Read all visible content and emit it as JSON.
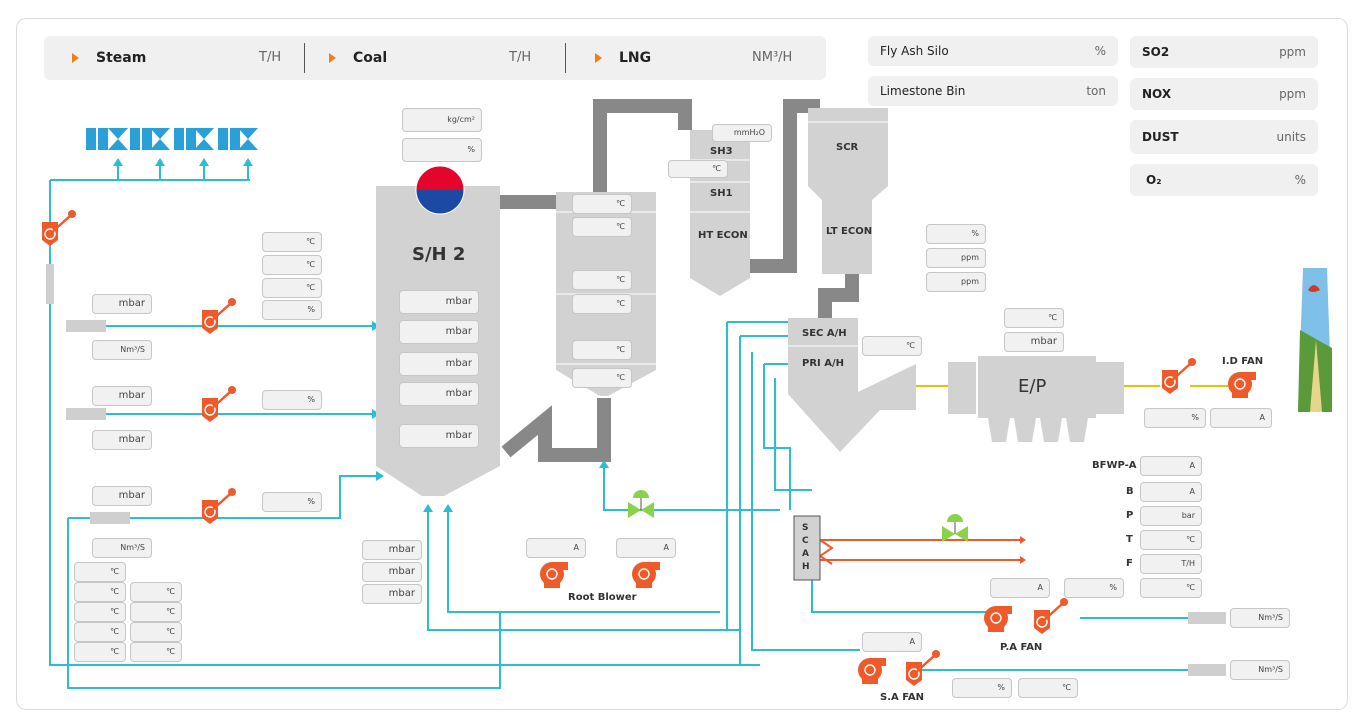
{
  "topbar": {
    "items": [
      {
        "label": "Steam",
        "unit": "T/H"
      },
      {
        "label": "Coal",
        "unit": "T/H"
      },
      {
        "label": "LNG",
        "unit": "NM³/H"
      }
    ]
  },
  "silo_panels": [
    {
      "label": "Fly Ash Silo",
      "unit": "%"
    },
    {
      "label": "Limestone Bin",
      "unit": "ton"
    }
  ],
  "emission_panels": [
    {
      "label": "SO2",
      "unit": "ppm"
    },
    {
      "label": "NOX",
      "unit": "ppm"
    },
    {
      "label": "DUST",
      "unit": "units"
    },
    {
      "label": "O₂",
      "unit": "%"
    }
  ],
  "equipment": {
    "sh2": "S/H 2",
    "sh3": "SH3",
    "sh1": "SH1",
    "ht_econ": "HT ECON",
    "scr": "SCR",
    "lt_econ": "LT ECON",
    "sec_ah": "SEC A/H",
    "pri_ah": "PRI A/H",
    "ep": "E/P",
    "id_fan": "I.D FAN",
    "pa_fan": "P.A FAN",
    "sa_fan": "S.A FAN",
    "root_blower": "Root Blower",
    "scah": [
      "S",
      "C",
      "A",
      "H"
    ]
  },
  "bfwp": {
    "labels": [
      "BFWP-A",
      "B",
      "P",
      "T",
      "F"
    ],
    "units": [
      "A",
      "A",
      "bar",
      "℃",
      "T/H"
    ],
    "extra_unit": "℃"
  },
  "drum": {
    "units": [
      "kg/cm²",
      "%"
    ]
  },
  "left_temps_top": [
    "℃",
    "℃",
    "℃",
    "%"
  ],
  "line_boxes": {
    "l1_mbar": "mbar",
    "l1_flow": "Nm³/S",
    "l2_mbar": "mbar",
    "l2_mbar2": "mbar",
    "l2_pct": "%",
    "l3_mbar": "mbar",
    "l3_flow": "Nm³/S",
    "l3_pct": "%"
  },
  "furnace_mbar": [
    "mbar",
    "mbar",
    "mbar",
    "mbar",
    "mbar"
  ],
  "bottom_mbar": [
    "mbar",
    "mbar",
    "mbar"
  ],
  "bottom_temps": {
    "col1": [
      "℃",
      "℃",
      "℃",
      "℃",
      "℃"
    ],
    "col2": [
      "℃",
      "℃",
      "℃",
      "℃"
    ]
  },
  "backpass_temps": [
    "℃",
    "℃",
    "℃",
    "℃",
    "℃",
    "℃"
  ],
  "conv": {
    "mmh2o": "mmH₂O",
    "temp": "℃"
  },
  "gas_boxes": [
    "%",
    "ppm",
    "ppm"
  ],
  "ah_temp": "℃",
  "ep_boxes": [
    "℃",
    "mbar"
  ],
  "id_boxes": [
    "%",
    "A"
  ],
  "blower_boxes": [
    "A",
    "A"
  ],
  "pa_boxes": [
    "A",
    "%"
  ],
  "sa_boxes": [
    "A",
    "%",
    "℃"
  ],
  "flow_boxes": [
    "Nm³/S",
    "Nm³/S"
  ],
  "colors": {
    "pipe": "#2bbcd6",
    "fan": "#ef5a2b",
    "duct": "#888888",
    "equip": "#d2d2d2",
    "ash": "#f0c000",
    "accent": "#ef7d22"
  }
}
